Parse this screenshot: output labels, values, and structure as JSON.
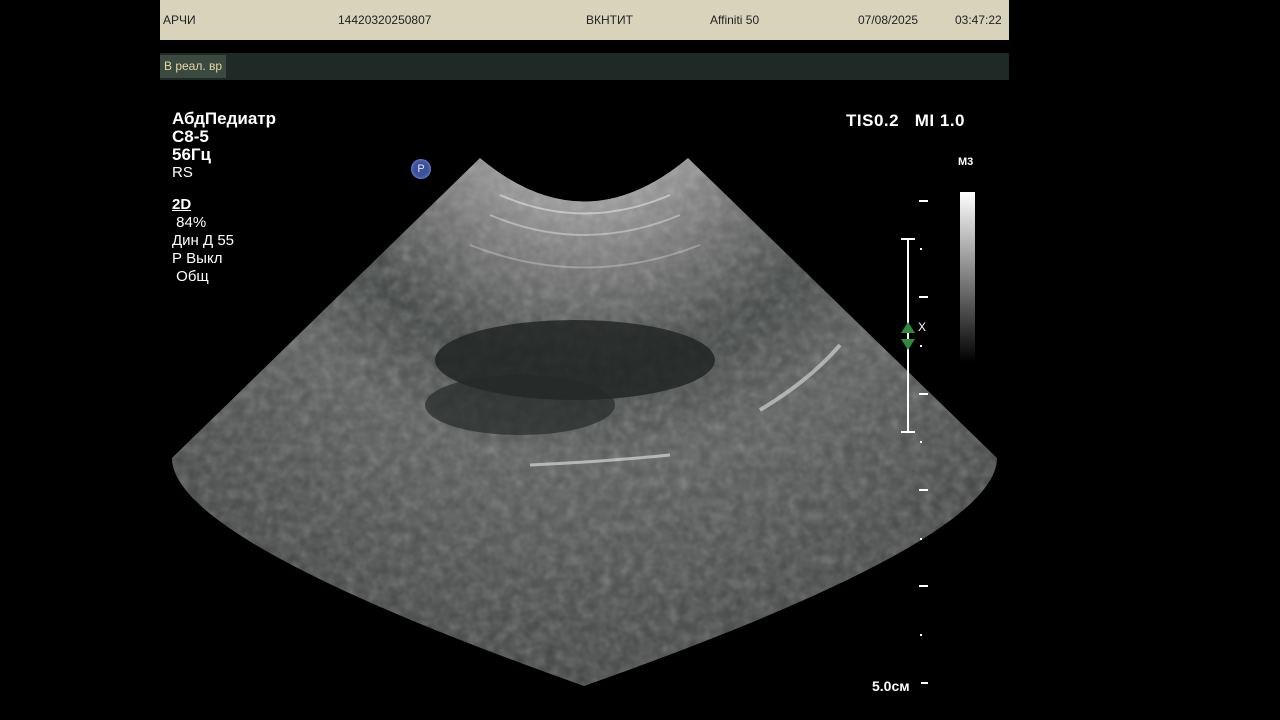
{
  "header": {
    "patient": "АРЧИ",
    "id": "14420320250807",
    "institution": "ВКНТИТ",
    "device": "Affiniti 50",
    "date": "07/08/2025",
    "time": "03:47:22"
  },
  "mode_bar": {
    "mode_label": "В реал. вр"
  },
  "params": {
    "preset": "АбдПедиатр",
    "probe": "C8-5",
    "frame_rate": "56Гц",
    "rs": "RS",
    "mode": "2D",
    "gain": " 84%",
    "dyn_range": "Дин Д 55",
    "p_state": "Р Выкл",
    "general": " Общ"
  },
  "safety": {
    "tis": "TIS0.2",
    "mi": "MI 1.0"
  },
  "gray_map": {
    "label": "М3"
  },
  "focus": {
    "marker": "X"
  },
  "depth": {
    "label": "5.0см"
  },
  "orientation": {
    "badge": "P"
  }
}
